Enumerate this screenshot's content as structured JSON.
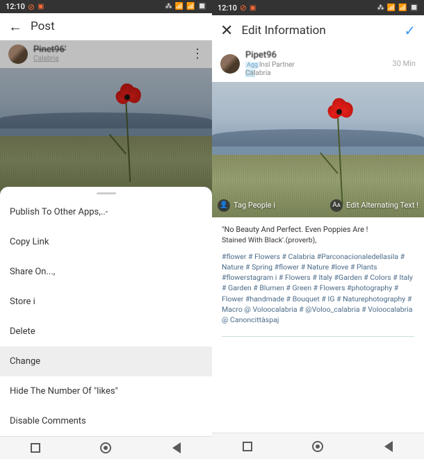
{
  "status": {
    "time": "12:10",
    "icons_right": [
      "bt",
      "sig1",
      "sig2",
      "batt"
    ]
  },
  "left": {
    "topbar": {
      "title": "Post"
    },
    "user": {
      "name": "Pinet96'",
      "location": "Calabria"
    },
    "sheet": {
      "items": [
        {
          "label": "Publish To Other Apps,..-",
          "selected": false
        },
        {
          "label": "Copy Link",
          "selected": false
        },
        {
          "label": "Share On...,",
          "selected": false
        },
        {
          "label": "Store i",
          "selected": false
        },
        {
          "label": "Delete",
          "selected": false
        },
        {
          "label": "Change",
          "selected": true
        },
        {
          "label": "Hide The Number Of \"likes\"",
          "selected": false
        },
        {
          "label": "Disable Comments",
          "selected": false
        }
      ]
    }
  },
  "right": {
    "topbar": {
      "title": "Edit Information"
    },
    "user": {
      "name": "Pipet96",
      "badge_prefix": "Agg",
      "badge_text": "lnsl Partner",
      "location_hl": "Cal",
      "location_rest": "abria",
      "time": "30 Min"
    },
    "photo_actions": {
      "tag_label": "Tag People i",
      "alt_label": "Edit Alternating Text !"
    },
    "caption": {
      "quote": "\"No Beauty And Perfect. Even Poppies Are !",
      "quote_sub": "Stained With Black'.(proverb),",
      "hashtags": "#flower # Flowers # Calabria #Parconacionaledellasila # Nature # Spring #flower # Nature #love # Plants #flowerstagram i # Flowers # Italy #Garden # Colors # Italy # Garden # Blumen # Green # Flowers #photography # Flower #handmade # Bouquet # IG # Naturephotography # Macro @ Voloocalabria # @Voloo_calabria # Voloocalabria @ Canoncittàspaj"
    }
  }
}
